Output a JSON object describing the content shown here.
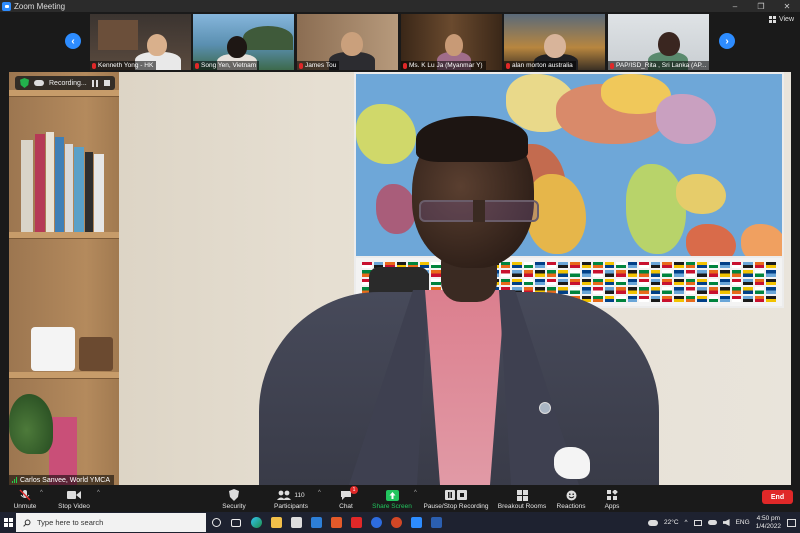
{
  "window": {
    "title": "Zoom Meeting",
    "controls": [
      "–",
      "❐",
      "✕"
    ]
  },
  "strip": {
    "view_label": "View",
    "participants": [
      {
        "name": "Kenneth Yong - HK"
      },
      {
        "name": "Song Yen, Vietnam"
      },
      {
        "name": "James Tou"
      },
      {
        "name": "Ms. K Lu Ja (Myanmar Y)"
      },
      {
        "name": "alan morton australia"
      },
      {
        "name": "PAP/ISD_Rita , Sri Lanka (AP..."
      }
    ]
  },
  "main_video": {
    "speaker_name": "Carlos Sanvee, World YMCA",
    "recording_label": "Recording..."
  },
  "toolbar": {
    "unmute": "Unmute",
    "stop_video": "Stop Video",
    "security": "Security",
    "participants": "Participants",
    "participants_count": "110",
    "chat": "Chat",
    "chat_badge": "1",
    "share_screen": "Share Screen",
    "pause_recording": "Pause/Stop Recording",
    "breakout_rooms": "Breakout Rooms",
    "reactions": "Reactions",
    "apps": "Apps",
    "end": "End"
  },
  "taskbar": {
    "search_placeholder": "Type here to search",
    "weather": "22°C",
    "language": "ENG",
    "time": "4:50 pm",
    "date": "1/4/2022"
  },
  "colors": {
    "accent": "#2d8cff",
    "end": "#e02828",
    "share": "#22c55e"
  }
}
